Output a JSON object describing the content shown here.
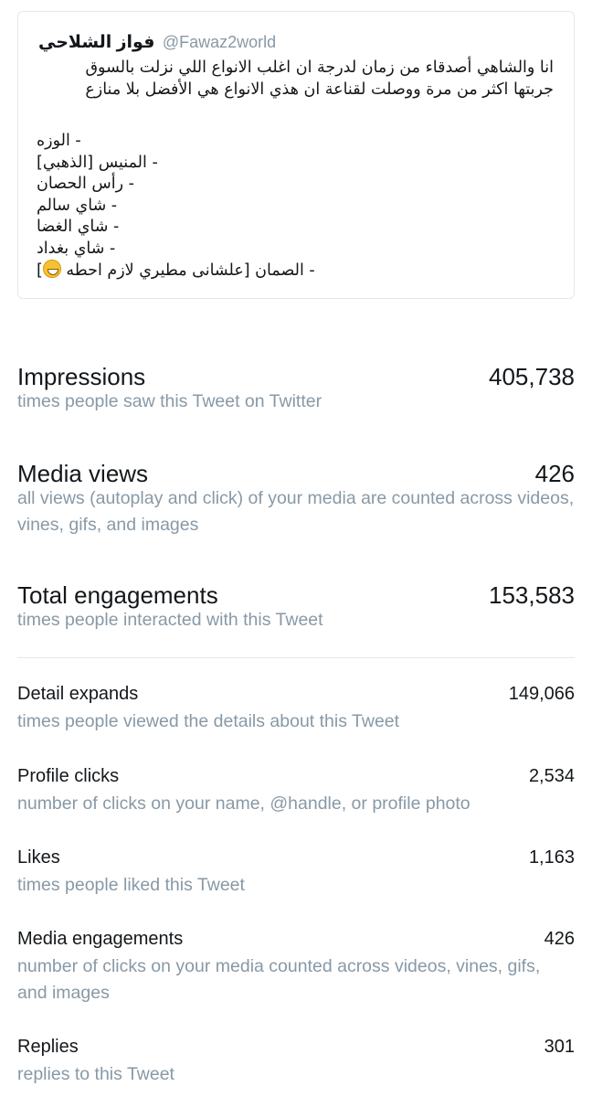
{
  "tweet": {
    "name": "فواز الشلاحي",
    "handle": "@Fawaz2world",
    "text_line1": "انا والشاهي أصدقاء من زمان لدرجة ان اغلب الانواع اللي نزلت بالسوق",
    "text_line2": "جربتها اكثر من مرة ووصلت لقناعة ان هذي الانواع هي الأفضل بلا منازع",
    "list": [
      "- الوزه",
      "- المنيس [الذهبي]",
      "- رأس الحصان",
      "- شاي سالم",
      "- شاي الغضا",
      "- شاي بغداد",
      "- الصمان [علشانى مطيري لازم احطه"
    ],
    "list_end": "]",
    "emoji": "grinning-face-emoji"
  },
  "metrics_primary": [
    {
      "label": "Impressions",
      "value": "405,738",
      "desc": "times people saw this Tweet on Twitter"
    },
    {
      "label": "Media views",
      "value": "426",
      "desc": "all views (autoplay and click) of your media are counted across videos, vines, gifs, and images"
    },
    {
      "label": "Total engagements",
      "value": "153,583",
      "desc": "times people interacted with this Tweet"
    }
  ],
  "metrics_detail": [
    {
      "label": "Detail expands",
      "value": "149,066",
      "desc": "times people viewed the details about this Tweet"
    },
    {
      "label": "Profile clicks",
      "value": "2,534",
      "desc": "number of clicks on your name, @handle, or profile photo"
    },
    {
      "label": "Likes",
      "value": "1,163",
      "desc": "times people liked this Tweet"
    },
    {
      "label": "Media engagements",
      "value": "426",
      "desc": "number of clicks on your media counted across videos, vines, gifs, and images"
    },
    {
      "label": "Replies",
      "value": "301",
      "desc": "replies to this Tweet"
    }
  ],
  "colors": {
    "text": "#14171a",
    "muted": "#8899a6",
    "border": "#e1e8ed"
  }
}
